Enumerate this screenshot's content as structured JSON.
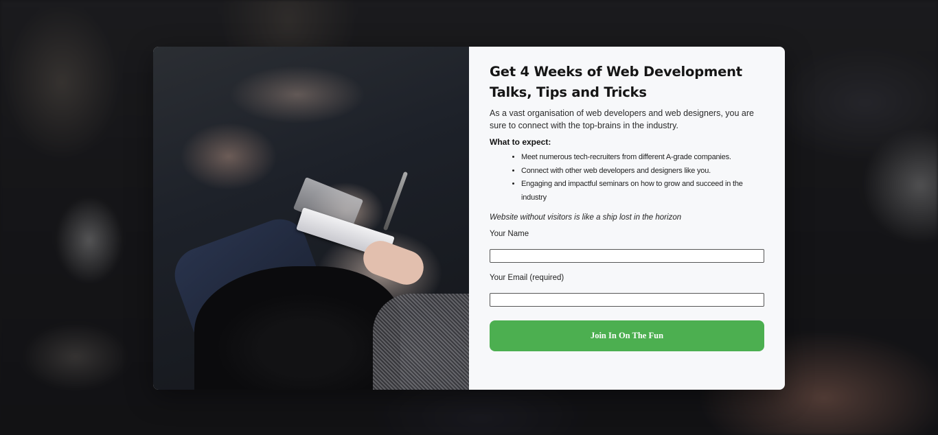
{
  "form": {
    "headline": "Get 4 Weeks of Web Development Talks, Tips and Tricks",
    "intro": "As a vast organisation of web developers and web designers, you are sure to connect with the top-brains in the industry.",
    "expect_title": "What to expect:",
    "expect_items": [
      "Meet numerous tech-recruiters from different A-grade companies.",
      "Connect with other web developers and designers like you.",
      "Engaging and impactful seminars on how to grow and succeed in the industry"
    ],
    "tagline": "Website without visitors is like a ship lost in the horizon",
    "name_label": "Your Name",
    "name_value": "",
    "email_label": "Your Email (required)",
    "email_value": "",
    "submit_label": "Join In On The Fun"
  },
  "colors": {
    "accent": "#4caf50",
    "panel_bg": "#f7f8fa"
  }
}
